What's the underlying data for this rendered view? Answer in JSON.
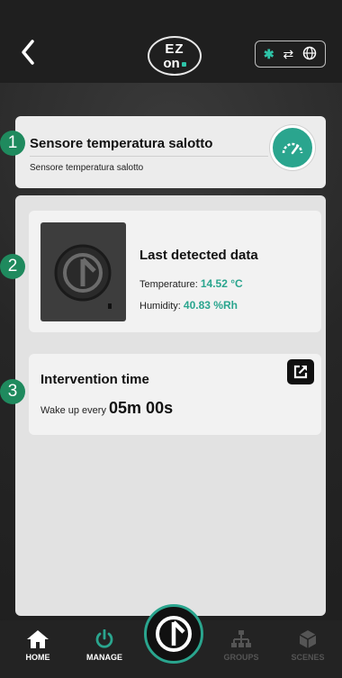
{
  "header": {
    "logo_line1": "EZ",
    "logo_line2": "on",
    "back_icon": "chevron-left-icon",
    "status_icons": [
      "bluetooth-icon",
      "sync-arrows-icon",
      "globe-icon"
    ],
    "accent_color": "#2aa58e"
  },
  "device": {
    "title": "Sensore temperatura salotto",
    "subtitle": "Sensore temperatura salotto",
    "gauge_icon": "speedometer-icon"
  },
  "last_data": {
    "title": "Last detected data",
    "temperature_label": "Temperature:",
    "temperature_value": "14.52 °C",
    "humidity_label": "Humidity:",
    "humidity_value": "40.83 %Rh"
  },
  "intervention": {
    "title": "Intervention time",
    "wake_label": "Wake up every",
    "wake_value": "05m 00s",
    "edit_icon": "external-link-icon"
  },
  "markers": [
    "1",
    "2",
    "3"
  ],
  "nav": {
    "items": [
      {
        "label": "HOME",
        "icon": "home-icon"
      },
      {
        "label": "MANAGE",
        "icon": "power-icon"
      },
      {
        "label": "GROUPS",
        "icon": "hierarchy-icon"
      },
      {
        "label": "SCENES",
        "icon": "cube-icon"
      }
    ]
  }
}
